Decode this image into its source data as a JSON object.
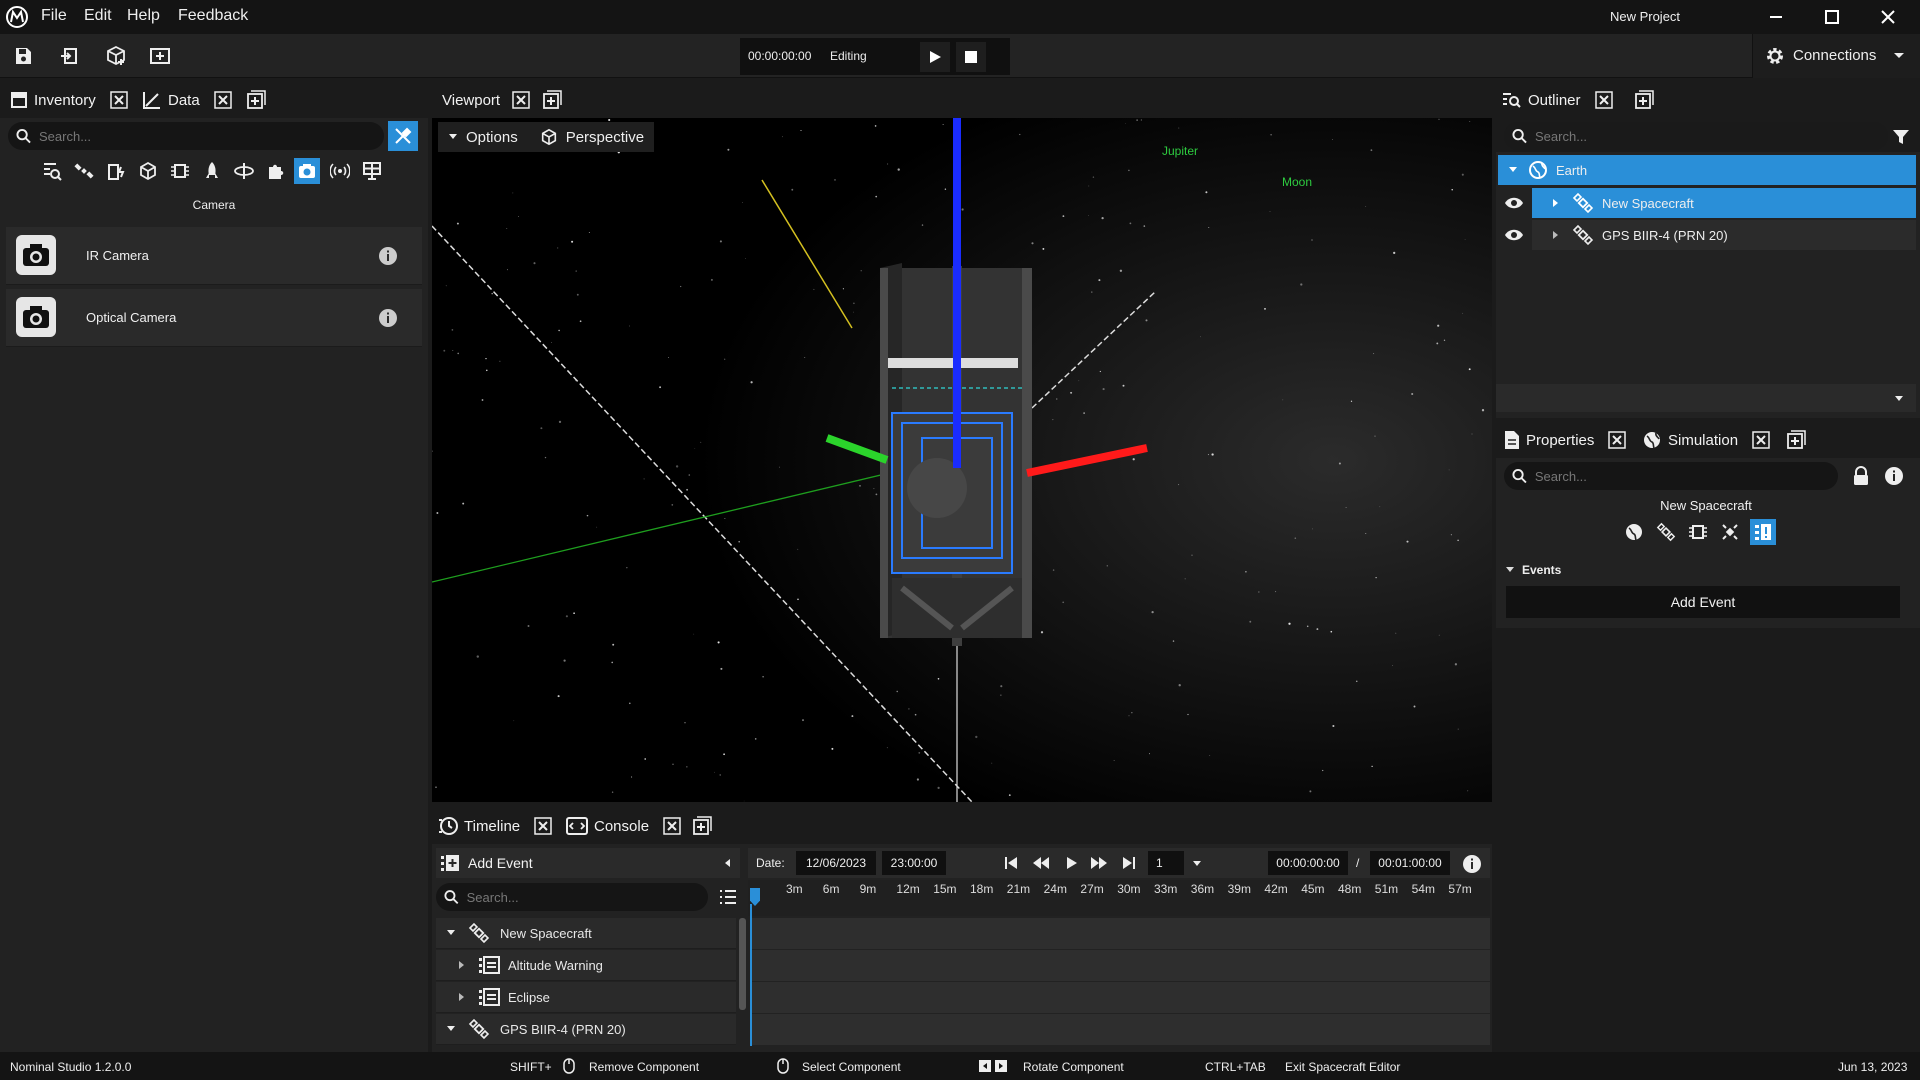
{
  "menubar": {
    "items": [
      "File",
      "Edit",
      "Help",
      "Feedback"
    ],
    "window_title": "New Project"
  },
  "toolbar": {
    "time": "00:00:00:00",
    "mode": "Editing",
    "connections_label": "Connections"
  },
  "left_panel": {
    "tabs": [
      {
        "label": "Inventory"
      },
      {
        "label": "Data"
      }
    ],
    "search_placeholder": "Search...",
    "category_icons": [
      "search-list-icon",
      "satellite-icon",
      "power-icon",
      "cube-icon",
      "chip-icon",
      "rocket-icon",
      "orbit-icon",
      "puzzle-icon",
      "camera-icon",
      "antenna-icon",
      "solar-panel-icon"
    ],
    "selected_category": "Camera",
    "items": [
      {
        "label": "IR Camera"
      },
      {
        "label": "Optical Camera"
      }
    ]
  },
  "viewport": {
    "tab_label": "Viewport",
    "options_label": "Options",
    "perspective_label": "Perspective",
    "labels": [
      "Jupiter",
      "Moon"
    ],
    "colors": {
      "x_axis": "#ff1a1a",
      "y_axis": "#2bd42b",
      "z_axis": "#1a2cff",
      "label_text": "#2ecc40"
    }
  },
  "outliner": {
    "tab_label": "Outliner",
    "search_placeholder": "Search...",
    "rows": [
      {
        "label": "Earth",
        "selected": true
      },
      {
        "label": "New Spacecraft",
        "selected": true
      },
      {
        "label": "GPS BIIR-4  (PRN 20)",
        "selected": false
      }
    ]
  },
  "properties": {
    "tabs": [
      {
        "label": "Properties"
      },
      {
        "label": "Simulation"
      }
    ],
    "search_placeholder": "Search...",
    "object_name": "New Spacecraft",
    "section": "Events",
    "add_event_label": "Add Event"
  },
  "timeline": {
    "tabs": [
      {
        "label": "Timeline"
      },
      {
        "label": "Console"
      }
    ],
    "add_event_label": "Add Event",
    "search_placeholder": "Search...",
    "date_label": "Date:",
    "date": "12/06/2023",
    "time": "23:00:00",
    "speed": "1",
    "current_time": "00:00:00:00",
    "separator": "/",
    "end_time": "00:01:00:00",
    "ticks": [
      "3m",
      "6m",
      "9m",
      "12m",
      "15m",
      "18m",
      "21m",
      "24m",
      "27m",
      "30m",
      "33m",
      "36m",
      "39m",
      "42m",
      "45m",
      "48m",
      "51m",
      "54m",
      "57m"
    ],
    "rows": [
      {
        "label": "New Spacecraft"
      },
      {
        "label": "Altitude Warning"
      },
      {
        "label": "Eclipse"
      },
      {
        "label": "GPS BIIR-4  (PRN 20)"
      }
    ]
  },
  "statusbar": {
    "version": "Nominal Studio 1.2.0.0",
    "shift_key": "SHIFT+",
    "remove_label": "Remove Component",
    "select_label": "Select Component",
    "rotate_label": "Rotate Component",
    "ctrl_tab": "CTRL+TAB",
    "exit_label": "Exit Spacecraft Editor",
    "date": "Jun 13, 2023"
  },
  "colors": {
    "accent": "#2a8fd8",
    "selected_row": "#2a8fd8",
    "background": "#1b1b1b"
  }
}
